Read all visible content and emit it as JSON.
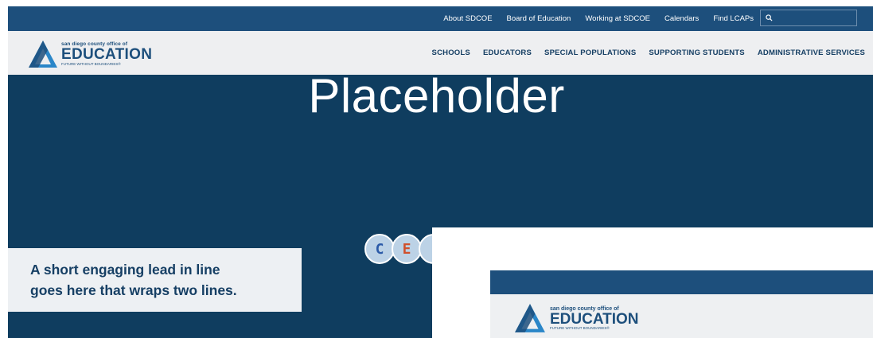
{
  "topbar": {
    "links": [
      "About SDCOE",
      "Board of Education",
      "Working at SDCOE",
      "Calendars",
      "Find LCAPs"
    ],
    "search_placeholder": ""
  },
  "logo": {
    "small_text": "san diego county office of",
    "big_text": "EDUCATION",
    "tagline": "FUTURE WITHOUT BOUNDARIES®"
  },
  "nav": {
    "items": [
      "SCHOOLS",
      "EDUCATORS",
      "SPECIAL POPULATIONS",
      "SUPPORTING STUDENTS",
      "ADMINISTRATIVE SERVICES"
    ]
  },
  "hero": {
    "title": "Placeholder",
    "lead_line1": "A short engaging lead in line",
    "lead_line2": "goes here that wraps two lines.",
    "badges": [
      "C",
      "E",
      ""
    ]
  },
  "thumbnail": {
    "logo_small": "san diego county office of",
    "logo_big": "EDUCATION",
    "logo_tagline": "FUTURE WITHOUT BOUNDARIES®"
  },
  "colors": {
    "top_bar": "#1d4f7c",
    "hero_bg": "#0f3d5f",
    "nav_bg": "#eeeff1",
    "text_blue": "#163f64",
    "badge_c": "#2b5aa8",
    "badge_e": "#d0502c"
  }
}
